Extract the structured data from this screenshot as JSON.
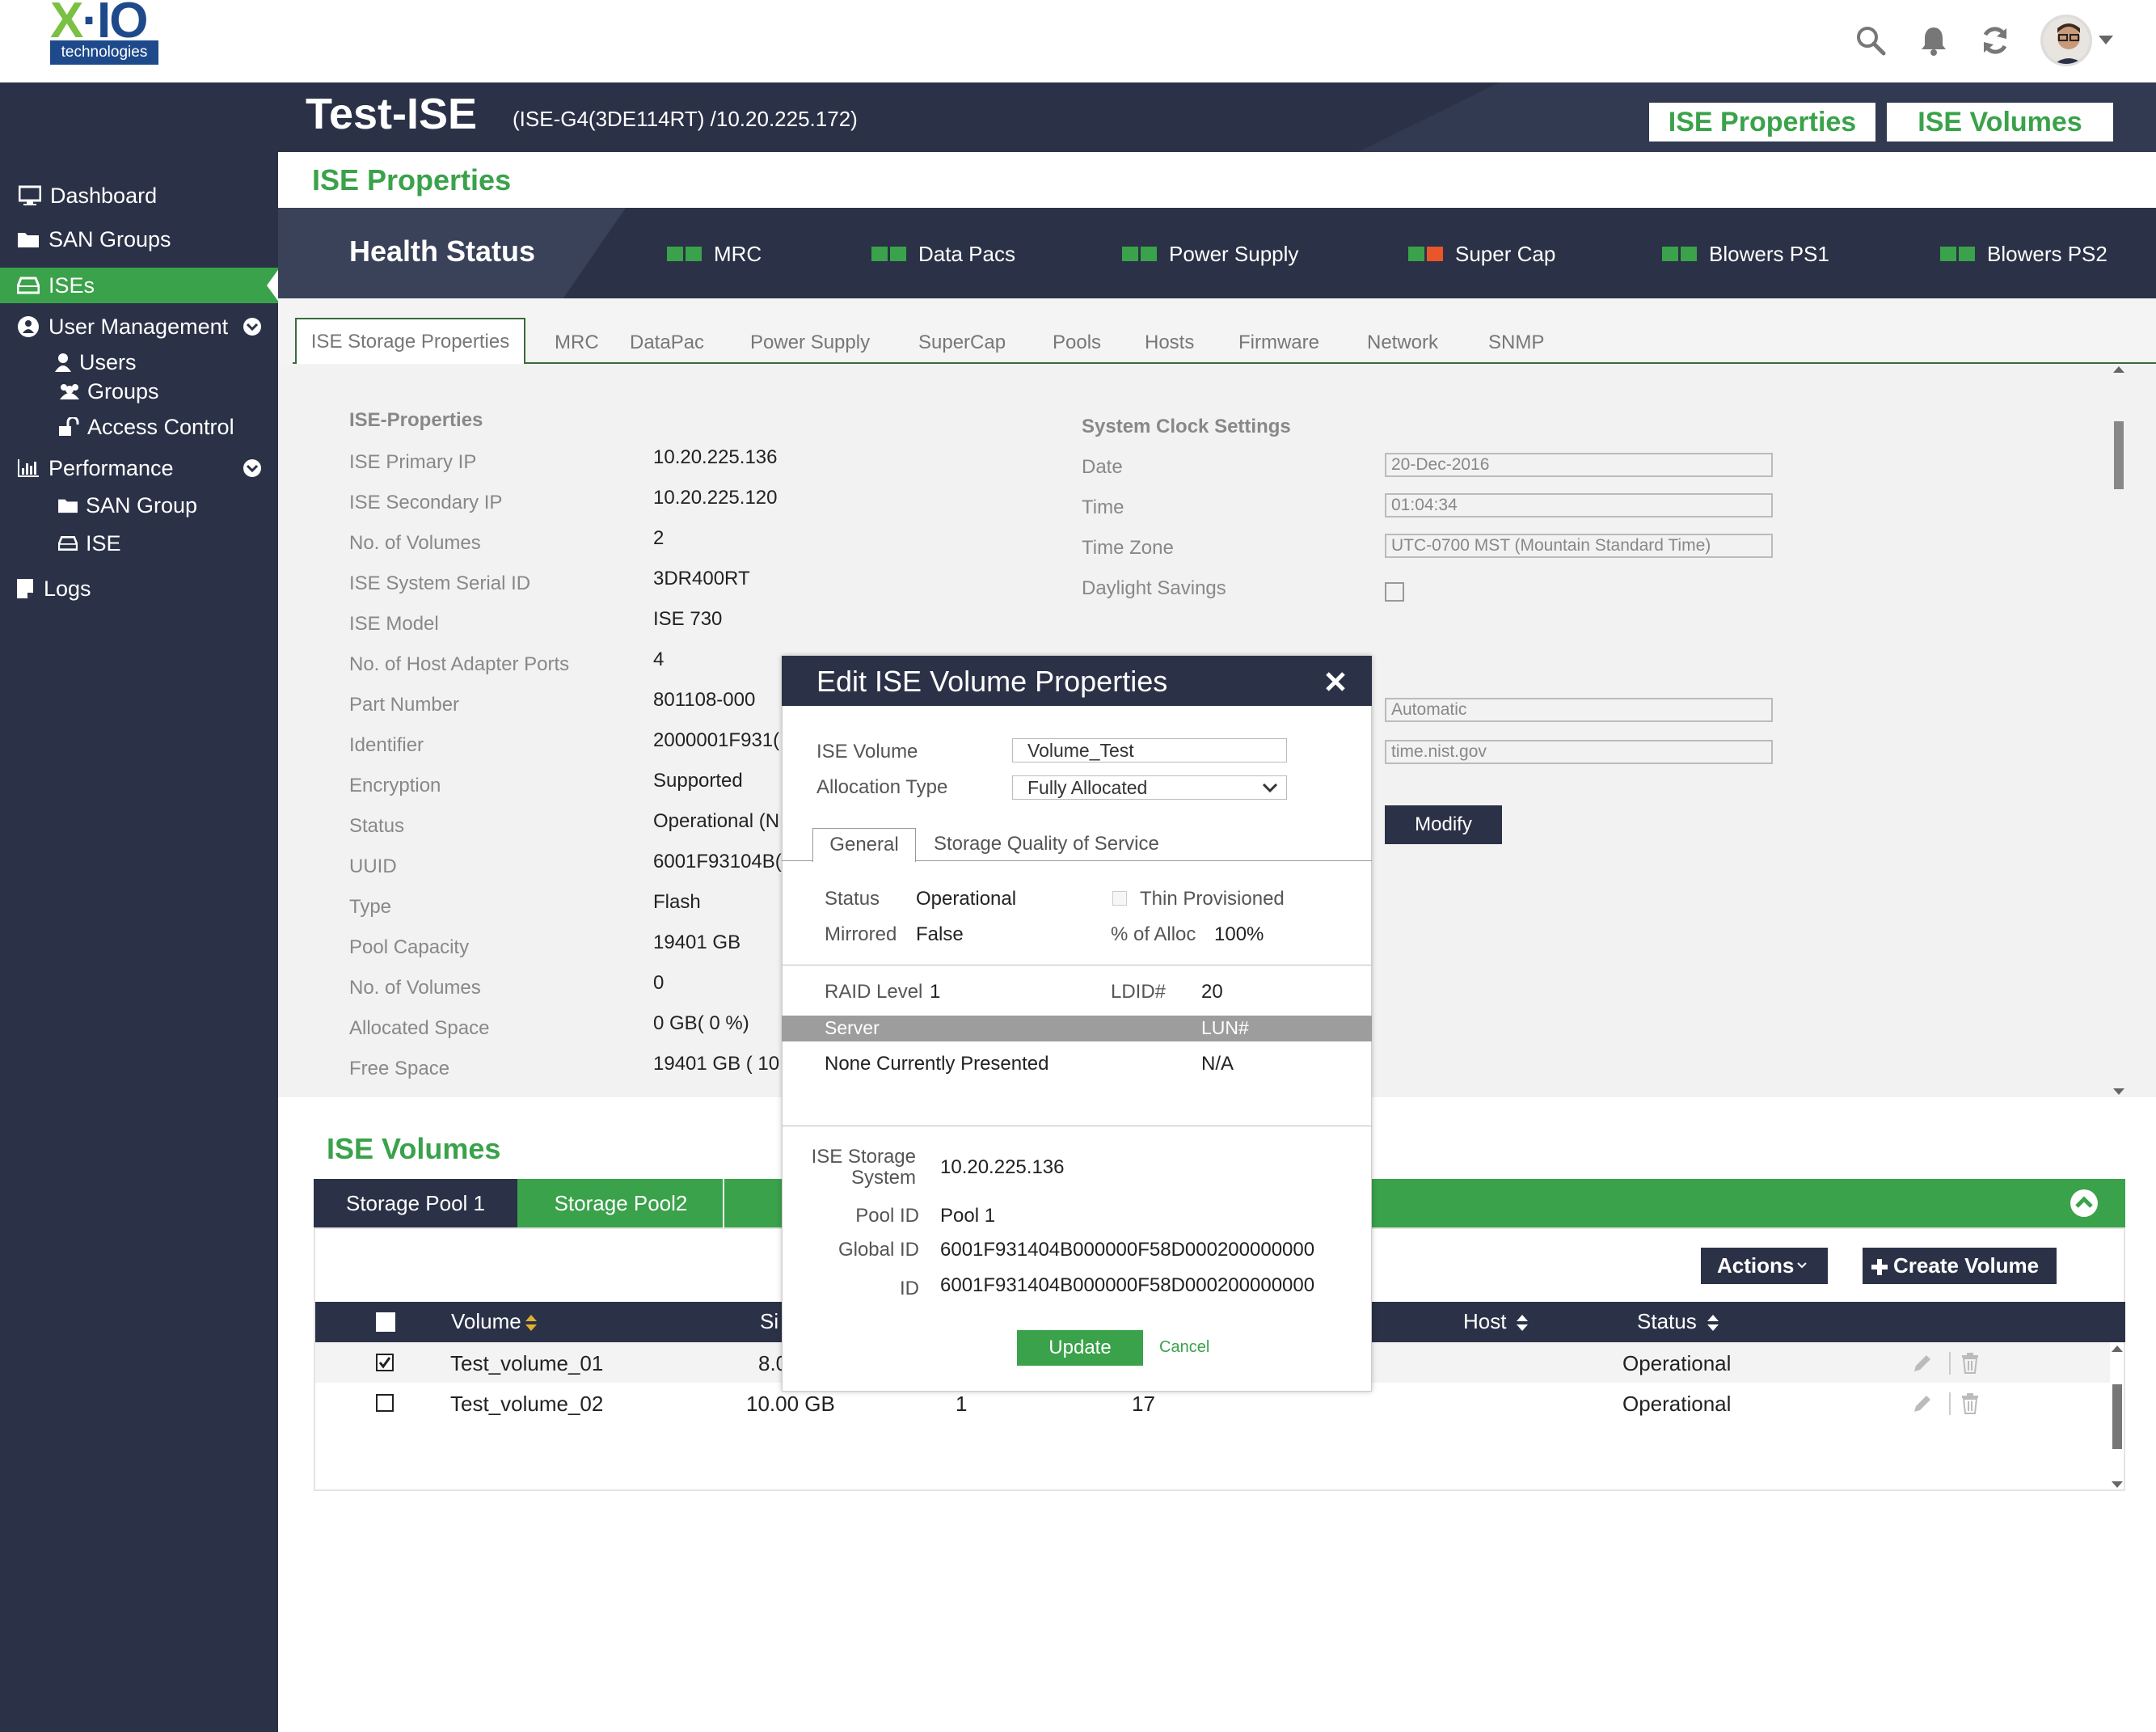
{
  "brand": {
    "logo_text": "X-IO",
    "logo_sub": "technologies"
  },
  "colors": {
    "green": "#3aa24a",
    "navy": "#2b3247",
    "orange": "#e8562a"
  },
  "topbar": {
    "icons": [
      "search-icon",
      "bell-icon",
      "refresh-icon",
      "avatar",
      "caret-down-icon"
    ]
  },
  "header": {
    "title": "Test-ISE",
    "subtitle": "(ISE-G4(3DE114RT) /10.20.225.172)",
    "btn_properties": "ISE Properties",
    "btn_volumes": "ISE Volumes"
  },
  "sidebar": {
    "items": [
      {
        "label": "Dashboard",
        "icon": "monitor-icon"
      },
      {
        "label": "SAN Groups",
        "icon": "folder-icon"
      },
      {
        "label": "ISEs",
        "icon": "drive-icon",
        "active": true
      },
      {
        "label": "User Management",
        "icon": "user-circle-icon"
      },
      {
        "label": "Users",
        "icon": "user-icon"
      },
      {
        "label": "Groups",
        "icon": "users-icon"
      },
      {
        "label": "Access Control",
        "icon": "unlock-icon"
      },
      {
        "label": "Performance",
        "icon": "bar-chart-icon"
      },
      {
        "label": "SAN Group",
        "icon": "folder-icon"
      },
      {
        "label": "ISE",
        "icon": "drive-icon"
      },
      {
        "label": "Logs",
        "icon": "document-icon"
      }
    ]
  },
  "main": {
    "section_title": "ISE Properties",
    "health": {
      "title": "Health Status",
      "items": [
        {
          "label": "MRC",
          "state": [
            "ok",
            "ok"
          ]
        },
        {
          "label": "Data Pacs",
          "state": [
            "ok",
            "ok"
          ]
        },
        {
          "label": "Power Supply",
          "state": [
            "ok",
            "ok"
          ]
        },
        {
          "label": "Super Cap",
          "state": [
            "ok",
            "warn"
          ]
        },
        {
          "label": "Blowers PS1",
          "state": [
            "ok",
            "ok"
          ]
        },
        {
          "label": "Blowers PS2",
          "state": [
            "ok",
            "ok"
          ]
        }
      ]
    },
    "tabs": [
      "ISE Storage Properties",
      "MRC",
      "DataPac",
      "Power Supply",
      "SuperCap",
      "Pools",
      "Hosts",
      "Firmware",
      "Network",
      "SNMP"
    ],
    "props": {
      "heading": "ISE-Properties",
      "rows": [
        {
          "label": "ISE Primary IP",
          "value": "10.20.225.136"
        },
        {
          "label": "ISE Secondary IP",
          "value": "10.20.225.120"
        },
        {
          "label": "No. of Volumes",
          "value": "2"
        },
        {
          "label": "ISE System Serial ID",
          "value": "3DR400RT"
        },
        {
          "label": "ISE Model",
          "value": "ISE 730"
        },
        {
          "label": "No. of Host Adapter Ports",
          "value": "4"
        },
        {
          "label": "Part Number",
          "value": "801108-000"
        },
        {
          "label": "Identifier",
          "value": "2000001F931("
        },
        {
          "label": "Encryption",
          "value": "Supported"
        },
        {
          "label": "Status",
          "value": "Operational (N"
        },
        {
          "label": "UUID",
          "value": "6001F93104B("
        },
        {
          "label": "Type",
          "value": "Flash"
        },
        {
          "label": "Pool Capacity",
          "value": "19401 GB"
        },
        {
          "label": "No. of Volumes",
          "value": "0"
        },
        {
          "label": "Allocated Space",
          "value": "0 GB( 0 %)"
        },
        {
          "label": "Free Space",
          "value": "19401 GB ( 10"
        }
      ]
    },
    "clock": {
      "heading": "System Clock Settings",
      "date_label": "Date",
      "date_value": "20-Dec-2016",
      "time_label": "Time",
      "time_value": "01:04:34",
      "tz_label": "Time Zone",
      "tz_value": "UTC-0700 MST (Mountain Standard Time)",
      "dst_label": "Daylight Savings",
      "mode_value": "Automatic",
      "ntp_value": "time.nist.gov",
      "modify_label": "Modify"
    }
  },
  "volumes": {
    "title": "ISE Volumes",
    "pool_tabs": [
      "Storage Pool 1",
      "Storage Pool2"
    ],
    "actions_label": "Actions",
    "create_label": "Create Volume",
    "columns": {
      "volume": "Volume",
      "size": "Si",
      "host": "Host",
      "status": "Status"
    },
    "rows": [
      {
        "name": "Test_volume_01",
        "size": "8.0",
        "raid": "",
        "ldid": "",
        "status": "Operational",
        "checked": true
      },
      {
        "name": "Test_volume_02",
        "size": "10.00 GB",
        "raid": "1",
        "ldid": "17",
        "status": "Operational",
        "checked": false
      }
    ]
  },
  "modal": {
    "title": "Edit ISE Volume Properties",
    "volume_label": "ISE  Volume",
    "volume_value": "Volume_Test",
    "alloc_label": "Allocation Type",
    "alloc_value": "Fully Allocated",
    "tab_general": "General",
    "tab_qos": "Storage Quality of Service",
    "status_label": "Status",
    "status_value": "Operational",
    "thin_label": "Thin Provisioned",
    "mirrored_label": "Mirrored",
    "mirrored_value": "False",
    "alloc_pct_label": "% of Alloc",
    "alloc_pct_value": "100%",
    "raid_label": "RAID Level",
    "raid_value": "1",
    "ldid_label": "LDID#",
    "ldid_value": "20",
    "server_col": "Server",
    "lun_col": "LUN#",
    "server_value": "None Currently Presented",
    "lun_value": "N/A",
    "iss_label_1": "ISE Storage",
    "iss_label_2": "System",
    "iss_value": "10.20.225.136",
    "pool_label": "Pool ID",
    "pool_value": "Pool 1",
    "global_label": "Global ID",
    "global_value": "6001F931404B000000F58D000200000000",
    "id_label": "ID",
    "id_value": "6001F931404B000000F58D000200000000",
    "update_label": "Update",
    "cancel_label": "Cancel"
  }
}
